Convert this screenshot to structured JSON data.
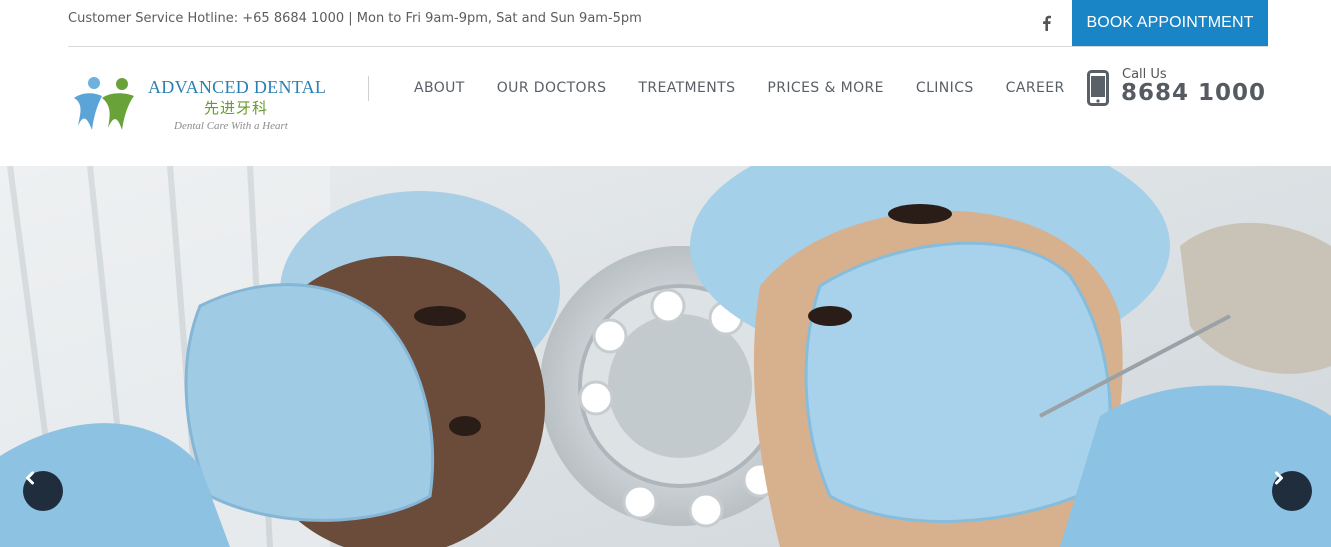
{
  "topbar": {
    "hotline": "Customer Service Hotline: +65 8684 1000 | Mon to Fri 9am-9pm, Sat and Sun 9am-5pm",
    "facebook_icon": "facebook-icon",
    "book_label": "BOOK APPOINTMENT"
  },
  "logo": {
    "title": "ADVANCED DENTAL",
    "chinese": "先进牙科",
    "tagline": "Dental Care With a Heart"
  },
  "nav": {
    "items": [
      {
        "label": "ABOUT"
      },
      {
        "label": "OUR DOCTORS"
      },
      {
        "label": "TREATMENTS"
      },
      {
        "label": "PRICES & MORE"
      },
      {
        "label": "CLINICS"
      },
      {
        "label": "CAREER"
      }
    ]
  },
  "call": {
    "label": "Call Us",
    "number": "8684 1000",
    "icon": "mobile-phone-icon"
  },
  "hero": {
    "prev_icon": "chevron-left-icon",
    "next_icon": "chevron-right-icon"
  },
  "colors": {
    "accent": "#1985c6",
    "nav_text": "#5a5f66",
    "arrow_bg": "#1f2d3d"
  }
}
